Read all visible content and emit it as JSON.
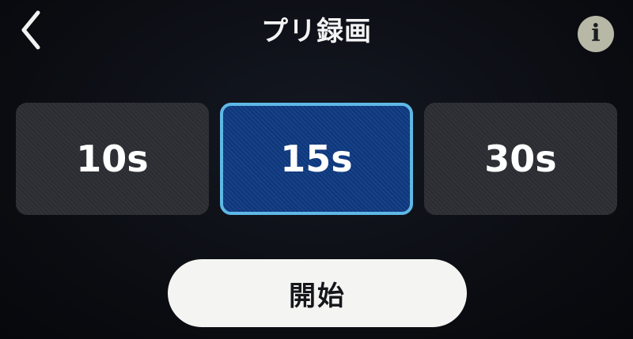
{
  "header": {
    "title": "プリ録画",
    "back_icon": "chevron-left-icon",
    "info_icon": "info-icon",
    "info_glyph": "i"
  },
  "durations": {
    "selected_index": 1,
    "options": [
      {
        "label": "10s",
        "selected": false
      },
      {
        "label": "15s",
        "selected": true
      },
      {
        "label": "30s",
        "selected": false
      }
    ]
  },
  "actions": {
    "start_label": "開始"
  },
  "colors": {
    "background": "#0b0d12",
    "option_background": "#2c2e33",
    "selected_background": "#0f3a82",
    "selected_border": "#5fb8e6",
    "info_badge": "#b7b8a6",
    "start_button": "#f4f4f2"
  }
}
